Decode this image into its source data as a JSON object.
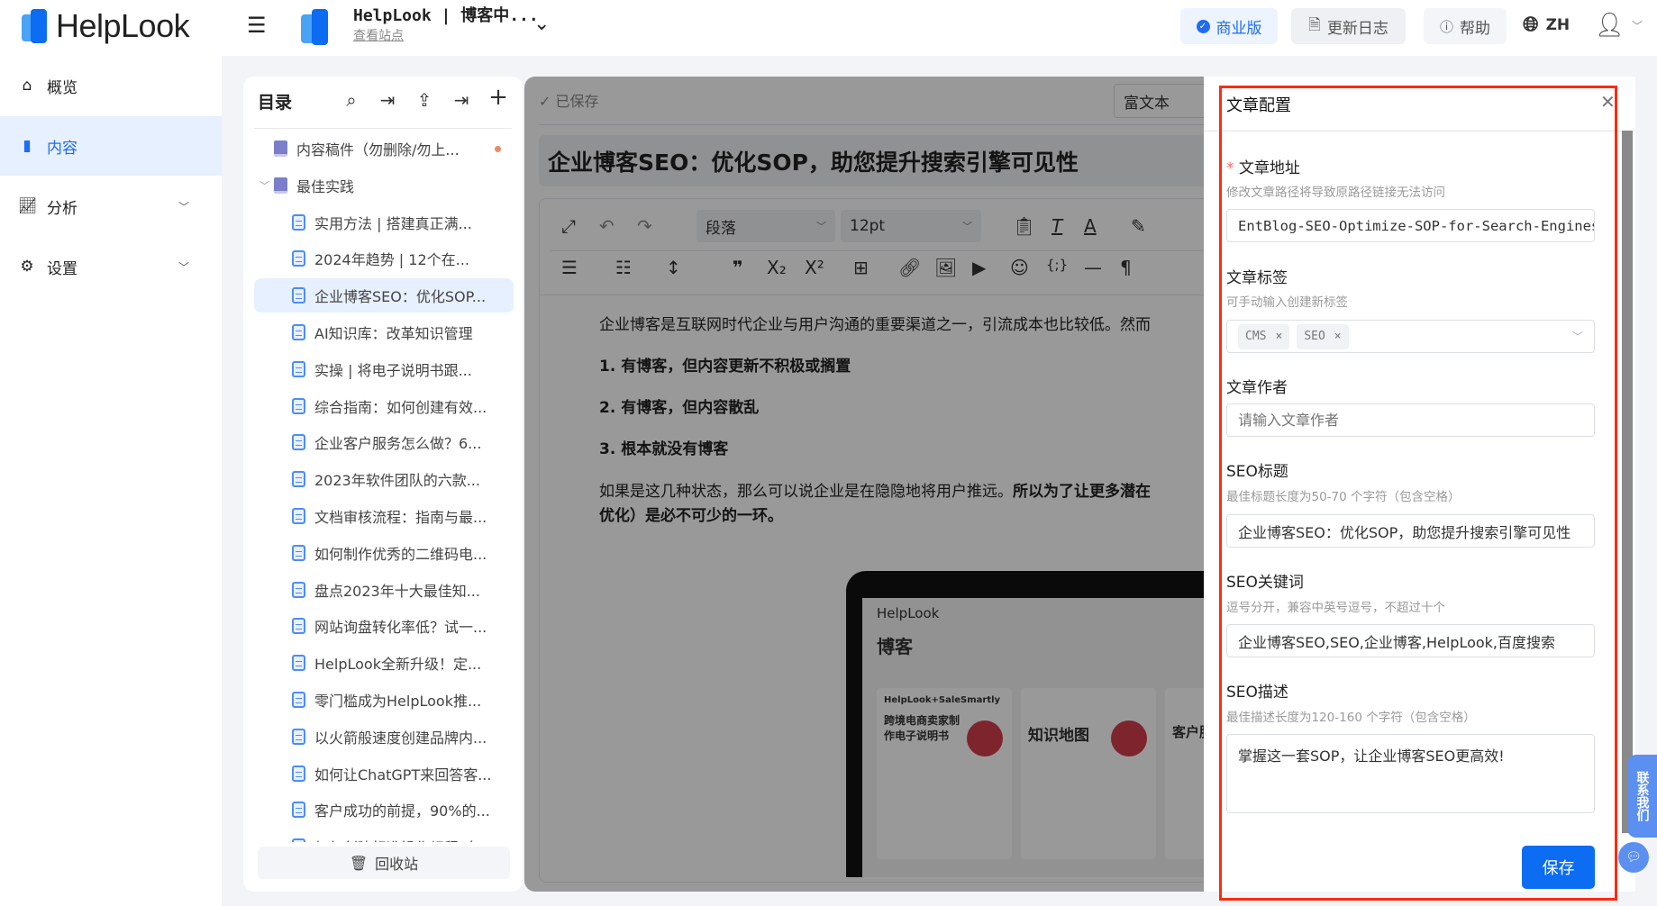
{
  "brand": {
    "name": "HelpLook"
  },
  "sidebar": {
    "items": [
      {
        "label": "概览",
        "icon": "home-icon"
      },
      {
        "label": "内容",
        "icon": "content-icon",
        "active": true
      },
      {
        "label": "分析",
        "icon": "chart-icon"
      },
      {
        "label": "设置",
        "icon": "gear-icon"
      }
    ]
  },
  "header": {
    "site_title": "HelpLook | 博客中...",
    "view_site": "查看站点",
    "edition": "商业版",
    "changelog": "更新日志",
    "help": "帮助",
    "lang": "ZH"
  },
  "toc": {
    "title": "目录",
    "items": [
      {
        "label": "内容稿件（勿删除/勿上...",
        "type": "book",
        "level": 0,
        "dot": true
      },
      {
        "label": "最佳实践",
        "type": "book",
        "level": 0,
        "expanded": true
      },
      {
        "label": "实用方法 | 搭建真正满...",
        "type": "doc",
        "level": 1
      },
      {
        "label": "2024年趋势 | 12个在...",
        "type": "doc",
        "level": 1
      },
      {
        "label": "企业博客SEO：优化SOP...",
        "type": "doc",
        "level": 1,
        "active": true
      },
      {
        "label": "AI知识库：改革知识管理",
        "type": "doc",
        "level": 1
      },
      {
        "label": "实操 | 将电子说明书跟...",
        "type": "doc",
        "level": 1
      },
      {
        "label": "综合指南：如何创建有效...",
        "type": "doc",
        "level": 1
      },
      {
        "label": "企业客户服务怎么做？6...",
        "type": "doc",
        "level": 1
      },
      {
        "label": "2023年软件团队的六款...",
        "type": "doc",
        "level": 1
      },
      {
        "label": "文档审核流程：指南与最...",
        "type": "doc",
        "level": 1
      },
      {
        "label": "如何制作优秀的二维码电...",
        "type": "doc",
        "level": 1
      },
      {
        "label": "盘点2023年十大最佳知...",
        "type": "doc",
        "level": 1
      },
      {
        "label": "网站询盘转化率低？试一...",
        "type": "doc",
        "level": 1
      },
      {
        "label": "HelpLook全新升级！定...",
        "type": "doc",
        "level": 1
      },
      {
        "label": "零门槛成为HelpLook推...",
        "type": "doc",
        "level": 1
      },
      {
        "label": "以火箭般速度创建品牌内...",
        "type": "doc",
        "level": 1
      },
      {
        "label": "如何让ChatGPT来回答客...",
        "type": "doc",
        "level": 1
      },
      {
        "label": "客户成功的前提，90%的...",
        "type": "doc",
        "level": 1
      },
      {
        "label": "如何创建标准操作规程（...",
        "type": "doc",
        "level": 1
      }
    ],
    "recycle": "回收站"
  },
  "editor": {
    "saved": "已保存",
    "mode": "富文本",
    "title": "企业博客SEO：优化SOP，助您提升搜索引擎可见性",
    "paragraph_style": "段落",
    "font_size": "12pt",
    "body": {
      "p1": "企业博客是互联网时代企业与用户沟通的重要渠道之一，引流成本也比较低。然而",
      "h1": "1. 有博客，但内容更新不积极或搁置",
      "h2": "2. 有博客，但内容散乱",
      "h3": "3. 根本就没有博客",
      "p2a": "如果是这几种状态，那么可以说企业是在隐隐地将用户推远。",
      "p2b": "所以为了让更多潜在",
      "p3": "优化）是必不可少的一环。"
    },
    "image": {
      "brand": "HelpLook",
      "heading": "博客",
      "card1a": "HelpLook+SaleSmartly",
      "card1b": "跨境电商卖家制作电子说明书",
      "card2": "知识地图",
      "card3": "客户服务"
    }
  },
  "drawer": {
    "title": "文章配置",
    "save": "保存",
    "url": {
      "label": "文章地址",
      "help": "修改文章路径将导致原路径链接无法访问",
      "value": "EntBlog-SEO-Optimize-SOP-for-Search-Engines"
    },
    "tags": {
      "label": "文章标签",
      "help": "可手动输入创建新标签",
      "values": [
        "CMS",
        "SEO"
      ]
    },
    "author": {
      "label": "文章作者",
      "placeholder": "请输入文章作者"
    },
    "seo_title": {
      "label": "SEO标题",
      "help": "最佳标题长度为50-70 个字符（包含空格）",
      "value": "企业博客SEO：优化SOP，助您提升搜索引擎可见性"
    },
    "seo_keywords": {
      "label": "SEO关键词",
      "help": "逗号分开，兼容中英号逗号，不超过十个",
      "value": "企业博客SEO,SEO,企业博客,HelpLook,百度搜索"
    },
    "seo_desc": {
      "label": "SEO描述",
      "help": "最佳描述长度为120-160 个字符（包含空格）",
      "value": "掌握这一套SOP，让企业博客SEO更高效!"
    }
  },
  "contact": {
    "label": "联系我们"
  },
  "colors": {
    "accent": "#0c6cf2",
    "highlight_border": "#ff2a10"
  }
}
